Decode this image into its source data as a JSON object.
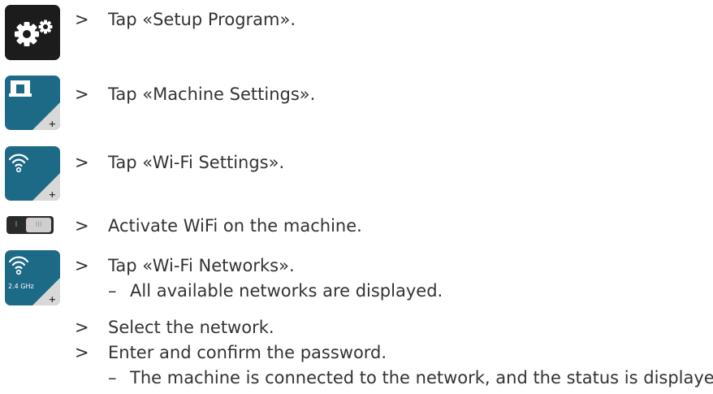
{
  "steps": [
    {
      "marker": ">",
      "text": "Tap «Setup Program».",
      "icon": "gear-icon"
    },
    {
      "marker": ">",
      "text": "Tap «Machine Settings».",
      "icon": "sewing-machine-icon"
    },
    {
      "marker": ">",
      "text": "Tap «Wi-Fi Settings».",
      "icon": "wifi-icon"
    },
    {
      "marker": ">",
      "text": "Activate WiFi on the machine.",
      "icon": "toggle-switch-icon",
      "toggle_on_label": "I",
      "toggle_off_label": "III"
    },
    {
      "marker": ">",
      "text": "Tap «Wi-Fi Networks».",
      "icon": "wifi-networks-icon",
      "icon_label": "2.4 GHz",
      "result": {
        "marker": "–",
        "text": "All available networks are displayed."
      }
    },
    {
      "marker": ">",
      "text": "Select the network."
    },
    {
      "marker": ">",
      "text": "Enter and confirm the password.",
      "result": {
        "marker": "–",
        "text": "The machine is connected to the network, and the status is displayed."
      }
    }
  ],
  "colors": {
    "icon_teal": "#1d6a86",
    "icon_dark": "#1c1c1c",
    "toggle_green": "#40d060"
  }
}
